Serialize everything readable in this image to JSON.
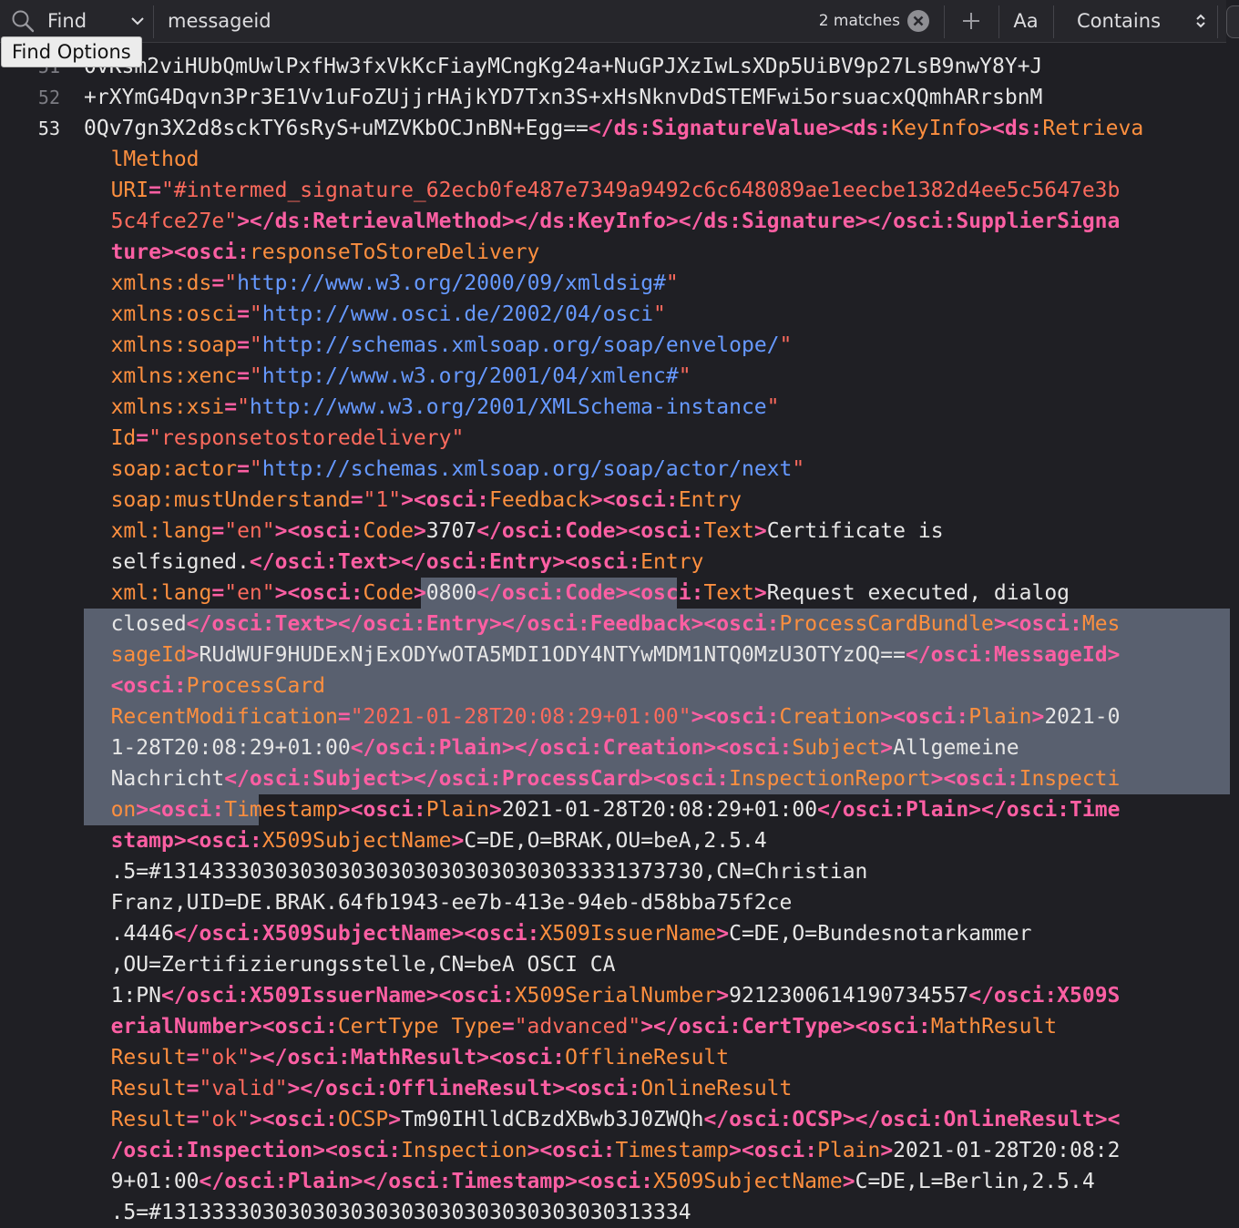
{
  "find_bar": {
    "mode_label": "Find",
    "query": "messageid",
    "match_count": "2 matches",
    "case_label": "Aa",
    "match_mode": "Contains"
  },
  "tooltip": "Find Options",
  "editor": {
    "gutter": [
      {
        "line": 0,
        "number": "51"
      },
      {
        "line": 1,
        "number": "52"
      },
      {
        "line": 2,
        "number": "53"
      }
    ],
    "selection": [
      {
        "line": 17,
        "from": 23,
        "to": 42
      },
      {
        "line": 18,
        "from": 0,
        "to": 43
      },
      {
        "line": 19,
        "from": 0,
        "to": 43
      },
      {
        "line": 20,
        "from": 0,
        "to": 43
      },
      {
        "line": 21,
        "from": 0,
        "to": 43
      },
      {
        "line": 22,
        "from": 0,
        "to": 43
      },
      {
        "line": 23,
        "from": 0,
        "to": 43
      },
      {
        "line": 24,
        "from": 0,
        "to": 11
      }
    ],
    "lines": [
      {
        "indent": 0,
        "t": [
          [
            "tx",
            "0vKsm2viHUbQmUwlPxfHw3fxVkKcFiayMCngKg24a+NuGPJXzIwLsXDp5UiBV9p27LsB9nwY8Y+J"
          ]
        ]
      },
      {
        "indent": 0,
        "t": [
          [
            "tx",
            "+rXYmG4Dqvn3Pr3E1Vv1uFoZUjjrHAjkYD7Txn3S+xHsNknvDdSTEMFwi5orsuacxQQmhARrsbnM"
          ]
        ]
      },
      {
        "indent": 0,
        "t": [
          [
            "tx",
            "0Qv7gn3X2d8sckTY6sRyS+uMZVKbOCJnBN+Egg=="
          ],
          [
            "pk",
            "</ds:SignatureValue><ds:"
          ],
          [
            "an",
            "KeyInfo"
          ],
          [
            "pk",
            "><ds:"
          ],
          [
            "an",
            "Retrieva"
          ]
        ]
      },
      {
        "indent": 2,
        "t": [
          [
            "an",
            "lMethod"
          ]
        ]
      },
      {
        "indent": 2,
        "t": [
          [
            "at",
            "URI"
          ],
          [
            "pk",
            "="
          ],
          [
            "sv",
            "\"#intermed_signature_62ecb0fe487e7349a9492c6c648089ae1eecbe1382d4ee5c5647e3b"
          ]
        ]
      },
      {
        "indent": 2,
        "t": [
          [
            "sv",
            "5c4fce27e\""
          ],
          [
            "pk",
            "></ds:RetrievalMethod></ds:KeyInfo></ds:Signature></osci:SupplierSigna"
          ]
        ]
      },
      {
        "indent": 2,
        "t": [
          [
            "pk",
            "ture><osci:"
          ],
          [
            "an",
            "responseToStoreDelivery"
          ]
        ]
      },
      {
        "indent": 2,
        "t": [
          [
            "at",
            "xmlns:ds"
          ],
          [
            "pk",
            "="
          ],
          [
            "sv",
            "\""
          ],
          [
            "ur",
            "http://www.w3.org/2000/09/xmldsig#"
          ],
          [
            "sv",
            "\""
          ]
        ]
      },
      {
        "indent": 2,
        "t": [
          [
            "at",
            "xmlns:osci"
          ],
          [
            "pk",
            "="
          ],
          [
            "sv",
            "\""
          ],
          [
            "ur",
            "http://www.osci.de/2002/04/osci"
          ],
          [
            "sv",
            "\""
          ]
        ]
      },
      {
        "indent": 2,
        "t": [
          [
            "at",
            "xmlns:soap"
          ],
          [
            "pk",
            "="
          ],
          [
            "sv",
            "\""
          ],
          [
            "ur",
            "http://schemas.xmlsoap.org/soap/envelope/"
          ],
          [
            "sv",
            "\""
          ]
        ]
      },
      {
        "indent": 2,
        "t": [
          [
            "at",
            "xmlns:xenc"
          ],
          [
            "pk",
            "="
          ],
          [
            "sv",
            "\""
          ],
          [
            "ur",
            "http://www.w3.org/2001/04/xmlenc#"
          ],
          [
            "sv",
            "\""
          ]
        ]
      },
      {
        "indent": 2,
        "t": [
          [
            "at",
            "xmlns:xsi"
          ],
          [
            "pk",
            "="
          ],
          [
            "sv",
            "\""
          ],
          [
            "ur",
            "http://www.w3.org/2001/XMLSchema-instance"
          ],
          [
            "sv",
            "\""
          ]
        ]
      },
      {
        "indent": 2,
        "t": [
          [
            "at",
            "Id"
          ],
          [
            "pk",
            "="
          ],
          [
            "sv",
            "\"responsetostoredelivery\""
          ]
        ]
      },
      {
        "indent": 2,
        "t": [
          [
            "at",
            "soap:actor"
          ],
          [
            "pk",
            "="
          ],
          [
            "sv",
            "\""
          ],
          [
            "ur",
            "http://schemas.xmlsoap.org/soap/actor/next"
          ],
          [
            "sv",
            "\""
          ]
        ]
      },
      {
        "indent": 2,
        "t": [
          [
            "at",
            "soap:mustUnderstand"
          ],
          [
            "pk",
            "="
          ],
          [
            "sv",
            "\"1\""
          ],
          [
            "pk",
            "><osci:"
          ],
          [
            "an",
            "Feedback"
          ],
          [
            "pk",
            "><osci:"
          ],
          [
            "an",
            "Entry"
          ]
        ]
      },
      {
        "indent": 2,
        "t": [
          [
            "at",
            "xml:lang"
          ],
          [
            "pk",
            "="
          ],
          [
            "sv",
            "\"en\""
          ],
          [
            "pk",
            "><osci:"
          ],
          [
            "an",
            "Code"
          ],
          [
            "pk",
            ">"
          ],
          [
            "tx",
            "3707"
          ],
          [
            "pk",
            "</osci:Code><osci:"
          ],
          [
            "an",
            "Text"
          ],
          [
            "pk",
            ">"
          ],
          [
            "tx",
            "Certificate is"
          ]
        ]
      },
      {
        "indent": 2,
        "t": [
          [
            "tx",
            "selfsigned."
          ],
          [
            "pk",
            "</osci:Text></osci:Entry><osci:"
          ],
          [
            "an",
            "Entry"
          ]
        ]
      },
      {
        "indent": 2,
        "t": [
          [
            "at",
            "xml:lang"
          ],
          [
            "pk",
            "="
          ],
          [
            "sv",
            "\"en\""
          ],
          [
            "pk",
            "><osci:"
          ],
          [
            "an",
            "Code"
          ],
          [
            "pk",
            ">"
          ],
          [
            "tx",
            "0800"
          ],
          [
            "pk",
            "</osci:Code><osci:"
          ],
          [
            "an",
            "Text"
          ],
          [
            "pk",
            ">"
          ],
          [
            "tx",
            "Request executed, dialog"
          ]
        ]
      },
      {
        "indent": 2,
        "t": [
          [
            "tx",
            "closed"
          ],
          [
            "pk",
            "</osci:Text></osci:Entry></osci:Feedback><osci:"
          ],
          [
            "an",
            "ProcessCardBundle"
          ],
          [
            "pk",
            "><osci:"
          ],
          [
            "an",
            "Mes"
          ]
        ]
      },
      {
        "indent": 2,
        "t": [
          [
            "an",
            "sageId"
          ],
          [
            "pk",
            ">"
          ],
          [
            "tx",
            "RUdWUF9HUDExNjExODYwOTA5MDI1ODY4NTYwMDM1NTQ0MzU3OTYzOQ=="
          ],
          [
            "pk",
            "</osci:MessageId>"
          ]
        ]
      },
      {
        "indent": 2,
        "t": [
          [
            "pk",
            "<osci:"
          ],
          [
            "an",
            "ProcessCard"
          ]
        ]
      },
      {
        "indent": 2,
        "t": [
          [
            "at",
            "RecentModification"
          ],
          [
            "pk",
            "="
          ],
          [
            "sv",
            "\"2021-01-28T20:08:29+01:00\""
          ],
          [
            "pk",
            "><osci:"
          ],
          [
            "an",
            "Creation"
          ],
          [
            "pk",
            "><osci:"
          ],
          [
            "an",
            "Plain"
          ],
          [
            "pk",
            ">"
          ],
          [
            "tx",
            "2021-0"
          ]
        ]
      },
      {
        "indent": 2,
        "t": [
          [
            "tx",
            "1-28T20:08:29+01:00"
          ],
          [
            "pk",
            "</osci:Plain></osci:Creation><osci:"
          ],
          [
            "an",
            "Subject"
          ],
          [
            "pk",
            ">"
          ],
          [
            "tx",
            "Allgemeine"
          ]
        ]
      },
      {
        "indent": 2,
        "t": [
          [
            "tx",
            "Nachricht"
          ],
          [
            "pk",
            "</osci:Subject></osci:ProcessCard><osci:"
          ],
          [
            "an",
            "InspectionReport"
          ],
          [
            "pk",
            "><osci:"
          ],
          [
            "an",
            "Inspecti"
          ]
        ]
      },
      {
        "indent": 2,
        "t": [
          [
            "an",
            "on"
          ],
          [
            "pk",
            "><osci:"
          ],
          [
            "an",
            "Timestamp"
          ],
          [
            "pk",
            "><osci:"
          ],
          [
            "an",
            "Plain"
          ],
          [
            "pk",
            ">"
          ],
          [
            "tx",
            "2021-01-28T20:08:29+01:00"
          ],
          [
            "pk",
            "</osci:Plain></osci:Time"
          ]
        ]
      },
      {
        "indent": 2,
        "t": [
          [
            "pk",
            "stamp><osci:"
          ],
          [
            "an",
            "X509SubjectName"
          ],
          [
            "pk",
            ">"
          ],
          [
            "tx",
            "C=DE,O=BRAK,OU=beA,2.5.4"
          ]
        ]
      },
      {
        "indent": 2,
        "t": [
          [
            "tx",
            ".5=#1314333030303030303030303030303033331373730,CN=Christian"
          ]
        ]
      },
      {
        "indent": 2,
        "t": [
          [
            "tx",
            "Franz,UID=DE.BRAK.64fb1943-ee7b-413e-94eb-d58bba75f2ce"
          ]
        ]
      },
      {
        "indent": 2,
        "t": [
          [
            "tx",
            ".4446"
          ],
          [
            "pk",
            "</osci:X509SubjectName><osci:"
          ],
          [
            "an",
            "X509IssuerName"
          ],
          [
            "pk",
            ">"
          ],
          [
            "tx",
            "C=DE,O=Bundesnotarkammer"
          ]
        ]
      },
      {
        "indent": 2,
        "t": [
          [
            "tx",
            ",OU=Zertifizierungsstelle,CN=beA OSCI CA"
          ]
        ]
      },
      {
        "indent": 2,
        "t": [
          [
            "tx",
            "1:PN"
          ],
          [
            "pk",
            "</osci:X509IssuerName><osci:"
          ],
          [
            "an",
            "X509SerialNumber"
          ],
          [
            "pk",
            ">"
          ],
          [
            "tx",
            "9212300614190734557"
          ],
          [
            "pk",
            "</osci:X509S"
          ]
        ]
      },
      {
        "indent": 2,
        "t": [
          [
            "pk",
            "erialNumber><osci:"
          ],
          [
            "an",
            "CertType Type"
          ],
          [
            "pk",
            "="
          ],
          [
            "sv",
            "\"advanced\""
          ],
          [
            "pk",
            "></osci:CertType><osci:"
          ],
          [
            "an",
            "MathResult"
          ]
        ]
      },
      {
        "indent": 2,
        "t": [
          [
            "at",
            "Result"
          ],
          [
            "pk",
            "="
          ],
          [
            "sv",
            "\"ok\""
          ],
          [
            "pk",
            "></osci:MathResult><osci:"
          ],
          [
            "an",
            "OfflineResult"
          ]
        ]
      },
      {
        "indent": 2,
        "t": [
          [
            "at",
            "Result"
          ],
          [
            "pk",
            "="
          ],
          [
            "sv",
            "\"valid\""
          ],
          [
            "pk",
            "></osci:OfflineResult><osci:"
          ],
          [
            "an",
            "OnlineResult"
          ]
        ]
      },
      {
        "indent": 2,
        "t": [
          [
            "at",
            "Result"
          ],
          [
            "pk",
            "="
          ],
          [
            "sv",
            "\"ok\""
          ],
          [
            "pk",
            "><osci:"
          ],
          [
            "an",
            "OCSP"
          ],
          [
            "pk",
            ">"
          ],
          [
            "tx",
            "Tm90IHlldCBzdXBwb3J0ZWQh"
          ],
          [
            "pk",
            "</osci:OCSP></osci:OnlineResult><"
          ]
        ]
      },
      {
        "indent": 2,
        "t": [
          [
            "pk",
            "/osci:Inspection><osci:"
          ],
          [
            "an",
            "Inspection"
          ],
          [
            "pk",
            "><osci:"
          ],
          [
            "an",
            "Timestamp"
          ],
          [
            "pk",
            "><osci:"
          ],
          [
            "an",
            "Plain"
          ],
          [
            "pk",
            ">"
          ],
          [
            "tx",
            "2021-01-28T20:08:2"
          ]
        ]
      },
      {
        "indent": 2,
        "t": [
          [
            "tx",
            "9+01:00"
          ],
          [
            "pk",
            "</osci:Plain></osci:Timestamp><osci:"
          ],
          [
            "an",
            "X509SubjectName"
          ],
          [
            "pk",
            ">"
          ],
          [
            "tx",
            "C=DE,L=Berlin,2.5.4"
          ]
        ]
      },
      {
        "indent": 2,
        "t": [
          [
            "tx",
            ".5=#131333303030303030303030303030303030313334"
          ]
        ]
      }
    ]
  }
}
